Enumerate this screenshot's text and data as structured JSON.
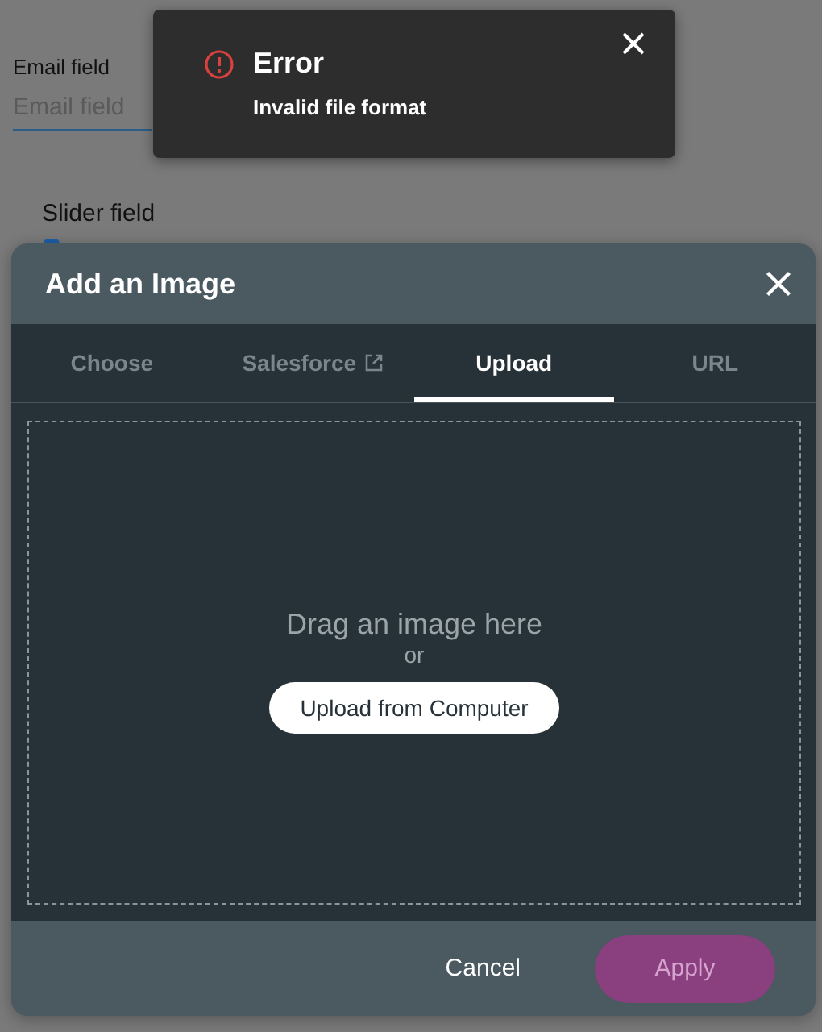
{
  "form": {
    "email_field": {
      "label": "Email field",
      "placeholder": "Email field"
    },
    "slider_field": {
      "label": "Slider field"
    }
  },
  "toast": {
    "title": "Error",
    "message": "Invalid file format"
  },
  "dialog": {
    "title": "Add an Image",
    "tabs": [
      {
        "label": "Choose",
        "selected": false,
        "external": false
      },
      {
        "label": "Salesforce",
        "selected": false,
        "external": true
      },
      {
        "label": "Upload",
        "selected": true,
        "external": false
      },
      {
        "label": "URL",
        "selected": false,
        "external": false
      }
    ],
    "dropzone": {
      "prompt": "Drag an image here",
      "separator": "or",
      "button": "Upload from Computer"
    },
    "buttons": [
      {
        "label": "Cancel",
        "kind": "text",
        "disabled": false
      },
      {
        "label": "Apply",
        "kind": "primary",
        "disabled": true
      }
    ]
  }
}
